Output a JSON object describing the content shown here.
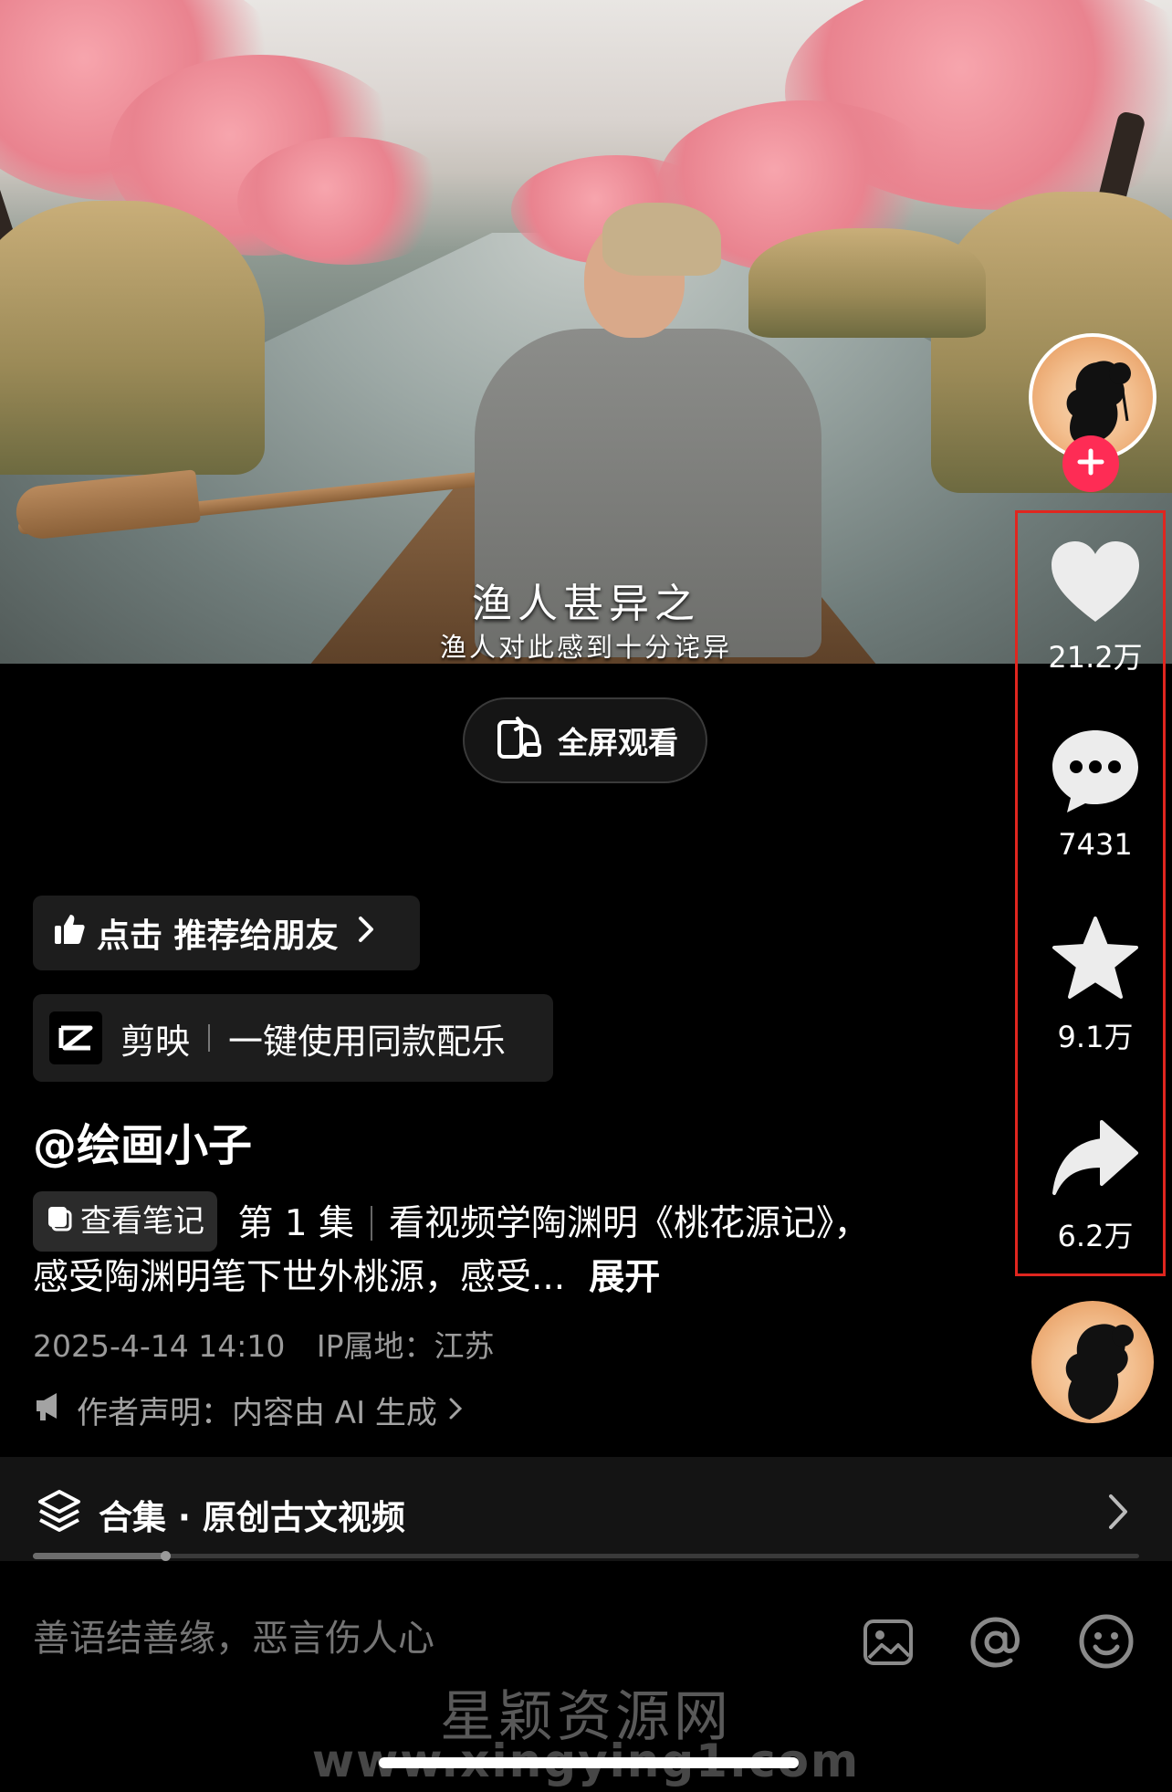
{
  "video": {
    "subtitle_classical": "渔人甚异之",
    "subtitle_modern": "渔人对此感到十分诧异"
  },
  "fullscreen_button": {
    "label": "全屏观看",
    "icon": "rotate-screen-icon"
  },
  "rail": {
    "follow_icon": "plus-icon",
    "like_count": "21.2万",
    "comment_count": "7431",
    "favorite_count": "9.1万",
    "share_count": "6.2万",
    "highlight_color": "#e0261f",
    "follow_color": "#fe2c55"
  },
  "recommend_chip": {
    "label": "点击 推荐给朋友",
    "icon": "thumbs-up-icon"
  },
  "capcut_chip": {
    "app": "剪映",
    "action": "一键使用同款配乐",
    "icon": "capcut-logo-icon"
  },
  "author": "@绘画小子",
  "description": {
    "note_chip": "查看笔记",
    "episode": "第 1 集",
    "text": "看视频学陶渊明《桃花源记》，感受陶渊明笔下世外桃源，感受...",
    "expand": "展开"
  },
  "meta": {
    "datetime": "2025-4-14 14:10",
    "ip_location": "IP属地：江苏"
  },
  "ai_declaration": {
    "label": "作者声明：内容由 AI 生成",
    "icon": "megaphone-icon"
  },
  "collection": {
    "title": "合集 · 原创古文视频",
    "icon": "layers-icon",
    "progress": 0.12
  },
  "comment_bar": {
    "placeholder": "善语结善缘，恶言伤人心",
    "icons": [
      "image-icon",
      "at-icon",
      "emoji-icon"
    ]
  },
  "watermark": {
    "line1": "星颖资源网",
    "line2": "www.xingying1.com"
  }
}
